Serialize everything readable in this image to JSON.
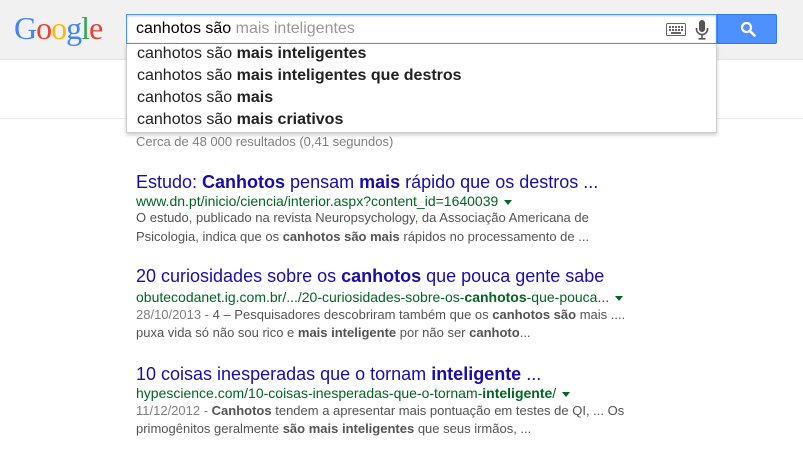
{
  "logo": {
    "letters": [
      "G",
      "o",
      "o",
      "g",
      "l",
      "e"
    ],
    "colors": [
      "#4285f4",
      "#ea4335",
      "#fbbc05",
      "#4285f4",
      "#34a853",
      "#ea4335"
    ]
  },
  "search": {
    "typed": "canhotos são",
    "hint": "mais inteligentes"
  },
  "icons": {
    "keyboard": "keyboard-icon",
    "mic": "microphone-icon",
    "search": "magnifier-icon"
  },
  "colors": {
    "accent": "#4d90fe",
    "link": "#1a0dab",
    "url": "#006621",
    "snippet": "#545454"
  },
  "suggestions": [
    {
      "prefix": "canhotos são ",
      "bold": "mais inteligentes"
    },
    {
      "prefix": "canhotos são ",
      "bold": "mais inteligentes que destros"
    },
    {
      "prefix": "canhotos são ",
      "bold": "mais"
    },
    {
      "prefix": "canhotos são ",
      "bold": "mais criativos"
    }
  ],
  "stats": "Cerca de 48 000 resultados (0,41 segundos)",
  "results": [
    {
      "title": [
        {
          "t": "Estudo: ",
          "b": false
        },
        {
          "t": "Canhotos",
          "b": true
        },
        {
          "t": " pensam ",
          "b": false
        },
        {
          "t": "mais",
          "b": true
        },
        {
          "t": " rápido que os destros ...",
          "b": false
        }
      ],
      "url": [
        {
          "t": "www.dn.pt/inicio/ciencia/interior.aspx?content_id=1640039",
          "b": false
        }
      ],
      "line1": [
        {
          "t": "O estudo, publicado na revista Neuropsychology, da Associação Americana de",
          "b": false
        }
      ],
      "line2": [
        {
          "t": "Psicologia, indica que os ",
          "b": false
        },
        {
          "t": "canhotos são mais",
          "b": true
        },
        {
          "t": " rápidos no processamento de ...",
          "b": false
        }
      ]
    },
    {
      "title": [
        {
          "t": "20 curiosidades sobre os ",
          "b": false
        },
        {
          "t": "canhotos",
          "b": true
        },
        {
          "t": " que pouca gente sabe",
          "b": false
        }
      ],
      "url": [
        {
          "t": "obutecodanet.ig.com.br/.../20-curiosidades-sobre-os-",
          "b": false
        },
        {
          "t": "canhotos",
          "b": true
        },
        {
          "t": "-que-pouca...",
          "b": false
        }
      ],
      "date": "28/10/2013 - ",
      "line1": [
        {
          "t": "4 – Pesquisadores descobriram também que os ",
          "b": false
        },
        {
          "t": "canhotos são",
          "b": true
        },
        {
          "t": " mais ....",
          "b": false
        }
      ],
      "line2": [
        {
          "t": "puxa vida só não sou rico e ",
          "b": false
        },
        {
          "t": "mais inteligente",
          "b": true
        },
        {
          "t": " por não ser ",
          "b": false
        },
        {
          "t": "canhoto",
          "b": true
        },
        {
          "t": "...",
          "b": false
        }
      ]
    },
    {
      "title": [
        {
          "t": "10 coisas inesperadas que o tornam ",
          "b": false
        },
        {
          "t": "inteligente",
          "b": true
        },
        {
          "t": " ...",
          "b": false
        }
      ],
      "url": [
        {
          "t": "hypescience.com/10-coisas-inesperadas-que-o-tornam-",
          "b": false
        },
        {
          "t": "inteligente",
          "b": true
        },
        {
          "t": "/",
          "b": false
        }
      ],
      "date": "11/12/2012 - ",
      "line1": [
        {
          "t": "Canhotos",
          "b": true
        },
        {
          "t": " tendem a apresentar mais pontuação em testes de QI, ... Os",
          "b": false
        }
      ],
      "line2": [
        {
          "t": "primogênitos geralmente ",
          "b": false
        },
        {
          "t": "são mais inteligentes",
          "b": true
        },
        {
          "t": " que seus irmãos, ...",
          "b": false
        }
      ]
    }
  ]
}
